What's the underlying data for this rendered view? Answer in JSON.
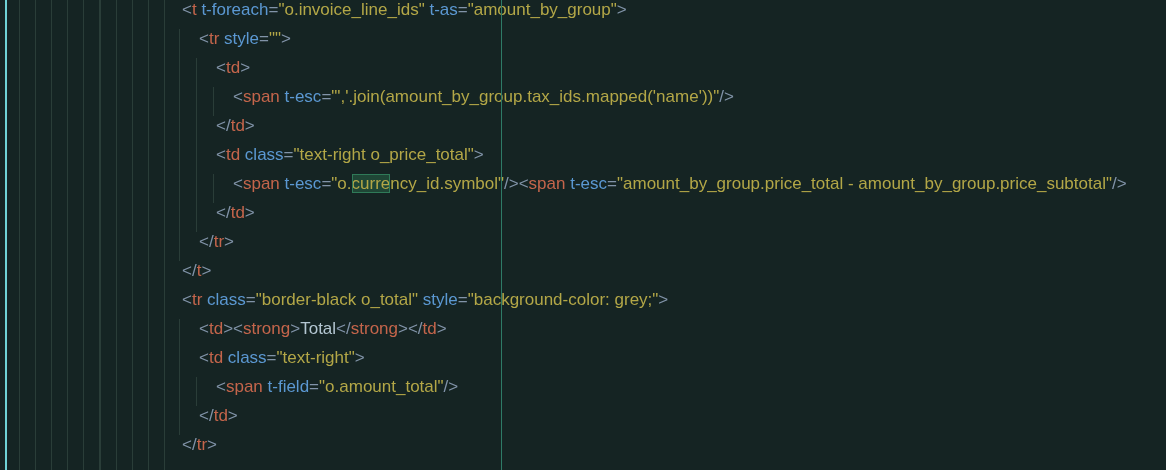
{
  "editor": {
    "lines": [
      {
        "tokens": [
          {
            "kind": "punct",
            "text": "<"
          },
          {
            "kind": "tag",
            "text": "t"
          },
          {
            "kind": "attr",
            "text": " t-foreach"
          },
          {
            "kind": "punct",
            "text": "="
          },
          {
            "kind": "string",
            "text": "\"o.invoice_line_ids\""
          },
          {
            "kind": "attr",
            "text": " t-as"
          },
          {
            "kind": "punct",
            "text": "="
          },
          {
            "kind": "string",
            "text": "\"amount_by_group\""
          },
          {
            "kind": "punct",
            "text": ">"
          }
        ],
        "children": [
          {
            "tokens": [
              {
                "kind": "punct",
                "text": "<"
              },
              {
                "kind": "tag",
                "text": "tr"
              },
              {
                "kind": "attr",
                "text": " style"
              },
              {
                "kind": "punct",
                "text": "="
              },
              {
                "kind": "string",
                "text": "\"\""
              },
              {
                "kind": "punct",
                "text": ">"
              }
            ],
            "children": [
              {
                "tokens": [
                  {
                    "kind": "punct",
                    "text": "<"
                  },
                  {
                    "kind": "tag",
                    "text": "td"
                  },
                  {
                    "kind": "punct",
                    "text": ">"
                  }
                ],
                "children": [
                  {
                    "tokens": [
                      {
                        "kind": "punct",
                        "text": "<"
                      },
                      {
                        "kind": "tag",
                        "text": "span"
                      },
                      {
                        "kind": "attr",
                        "text": " t-esc"
                      },
                      {
                        "kind": "punct",
                        "text": "="
                      },
                      {
                        "kind": "string",
                        "text": "\"','.join(amount_by_group.tax_ids.mapped('name'))\""
                      },
                      {
                        "kind": "punct",
                        "text": "/>"
                      }
                    ]
                  }
                ]
              },
              {
                "tokens": [
                  {
                    "kind": "punct",
                    "text": "</"
                  },
                  {
                    "kind": "tag",
                    "text": "td"
                  },
                  {
                    "kind": "punct",
                    "text": ">"
                  }
                ]
              },
              {
                "tokens": [
                  {
                    "kind": "punct",
                    "text": "<"
                  },
                  {
                    "kind": "tag",
                    "text": "td"
                  },
                  {
                    "kind": "attr",
                    "text": " class"
                  },
                  {
                    "kind": "punct",
                    "text": "="
                  },
                  {
                    "kind": "string",
                    "text": "\"text-right o_price_total\""
                  },
                  {
                    "kind": "punct",
                    "text": ">"
                  }
                ],
                "children": [
                  {
                    "tokens": [
                      {
                        "kind": "punct",
                        "text": "<"
                      },
                      {
                        "kind": "tag",
                        "text": "span"
                      },
                      {
                        "kind": "attr",
                        "text": " t-esc"
                      },
                      {
                        "kind": "punct",
                        "text": "="
                      },
                      {
                        "kind": "string",
                        "text": "\"o."
                      },
                      {
                        "kind": "string",
                        "text": "curre",
                        "highlighted": true
                      },
                      {
                        "kind": "string",
                        "text": "ncy_id.symbol\""
                      },
                      {
                        "kind": "punct",
                        "text": "/><"
                      },
                      {
                        "kind": "tag",
                        "text": "span"
                      },
                      {
                        "kind": "attr",
                        "text": " t-esc"
                      },
                      {
                        "kind": "punct",
                        "text": "="
                      },
                      {
                        "kind": "string",
                        "text": "\"amount_by_group.price_total - amount_by_group.price_subtotal\""
                      },
                      {
                        "kind": "punct",
                        "text": "/>"
                      }
                    ]
                  }
                ]
              },
              {
                "tokens": [
                  {
                    "kind": "punct",
                    "text": "</"
                  },
                  {
                    "kind": "tag",
                    "text": "td"
                  },
                  {
                    "kind": "punct",
                    "text": ">"
                  }
                ]
              }
            ]
          },
          {
            "tokens": [
              {
                "kind": "punct",
                "text": "</"
              },
              {
                "kind": "tag",
                "text": "tr"
              },
              {
                "kind": "punct",
                "text": ">"
              }
            ]
          }
        ]
      },
      {
        "tokens": [
          {
            "kind": "punct",
            "text": "</"
          },
          {
            "kind": "tag",
            "text": "t"
          },
          {
            "kind": "punct",
            "text": ">"
          }
        ]
      },
      {
        "tokens": [
          {
            "kind": "punct",
            "text": "<"
          },
          {
            "kind": "tag",
            "text": "tr"
          },
          {
            "kind": "attr",
            "text": " class"
          },
          {
            "kind": "punct",
            "text": "="
          },
          {
            "kind": "string",
            "text": "\"border-black o_total\""
          },
          {
            "kind": "attr",
            "text": " style"
          },
          {
            "kind": "punct",
            "text": "="
          },
          {
            "kind": "string",
            "text": "\"background-color: grey;\""
          },
          {
            "kind": "punct",
            "text": ">"
          }
        ],
        "children": [
          {
            "tokens": [
              {
                "kind": "punct",
                "text": "<"
              },
              {
                "kind": "tag",
                "text": "td"
              },
              {
                "kind": "punct",
                "text": "><"
              },
              {
                "kind": "tag",
                "text": "strong"
              },
              {
                "kind": "punct",
                "text": ">"
              },
              {
                "kind": "text",
                "text": "Total"
              },
              {
                "kind": "punct",
                "text": "</"
              },
              {
                "kind": "tag",
                "text": "strong"
              },
              {
                "kind": "punct",
                "text": "></"
              },
              {
                "kind": "tag",
                "text": "td"
              },
              {
                "kind": "punct",
                "text": ">"
              }
            ]
          },
          {
            "tokens": [
              {
                "kind": "punct",
                "text": "<"
              },
              {
                "kind": "tag",
                "text": "td"
              },
              {
                "kind": "attr",
                "text": " class"
              },
              {
                "kind": "punct",
                "text": "="
              },
              {
                "kind": "string",
                "text": "\"text-right\""
              },
              {
                "kind": "punct",
                "text": ">"
              }
            ],
            "children": [
              {
                "tokens": [
                  {
                    "kind": "punct",
                    "text": "<"
                  },
                  {
                    "kind": "tag",
                    "text": "span"
                  },
                  {
                    "kind": "attr",
                    "text": " t-field"
                  },
                  {
                    "kind": "punct",
                    "text": "="
                  },
                  {
                    "kind": "string",
                    "text": "\"o.amount_total\""
                  },
                  {
                    "kind": "punct",
                    "text": "/>"
                  }
                ]
              }
            ]
          },
          {
            "tokens": [
              {
                "kind": "punct",
                "text": "</"
              },
              {
                "kind": "tag",
                "text": "td"
              },
              {
                "kind": "punct",
                "text": ">"
              }
            ]
          }
        ]
      },
      {
        "tokens": [
          {
            "kind": "punct",
            "text": "</"
          },
          {
            "kind": "tag",
            "text": "tr"
          },
          {
            "kind": "punct",
            "text": ">"
          }
        ]
      }
    ]
  }
}
